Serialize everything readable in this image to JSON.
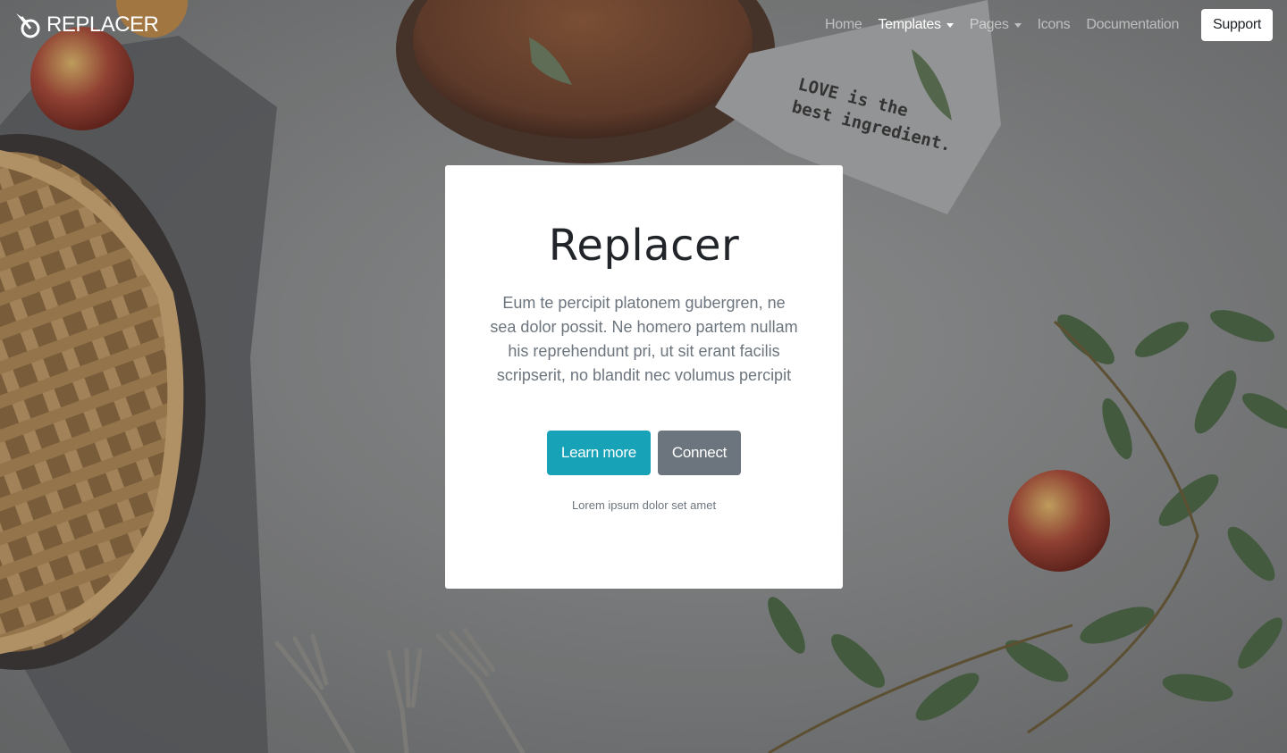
{
  "brand": {
    "name": "REPLACER",
    "logo_icon": "leaf-logo-icon"
  },
  "nav": {
    "items": [
      {
        "label": "Home",
        "active": false,
        "dropdown": false
      },
      {
        "label": "Templates",
        "active": true,
        "dropdown": true
      },
      {
        "label": "Pages",
        "active": false,
        "dropdown": true
      },
      {
        "label": "Icons",
        "active": false,
        "dropdown": false
      },
      {
        "label": "Documentation",
        "active": false,
        "dropdown": false
      }
    ],
    "support_label": "Support"
  },
  "hero": {
    "title": "Replacer",
    "text": "Eum te percipit platonem gubergren, ne sea dolor possit. Ne homero partem nullam his reprehendunt pri, ut sit erant facilis scripserit, no blandit nec volumus percipit",
    "primary_label": "Learn more",
    "secondary_label": "Connect",
    "small_text": "Lorem ipsum dolor set amet"
  },
  "background": {
    "towel_text_line1": "LOVE is the",
    "towel_text_line2": "best ingredient."
  },
  "colors": {
    "primary": "#17a2b8",
    "secondary": "#6c757d",
    "card": "#ffffff"
  }
}
